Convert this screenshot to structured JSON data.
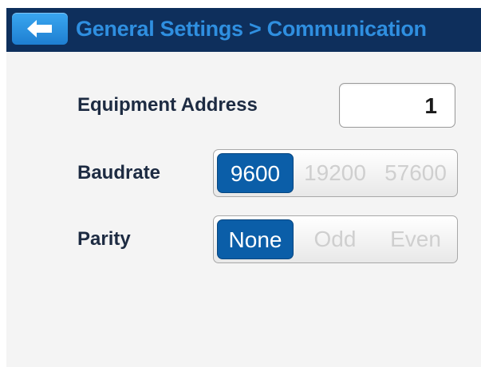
{
  "header": {
    "back_label": "back",
    "title": "General Settings > Communication"
  },
  "settings": {
    "equipment_address": {
      "label": "Equipment Address",
      "value": "1"
    },
    "baudrate": {
      "label": "Baudrate",
      "options": [
        "9600",
        "19200",
        "57600"
      ],
      "selected": "9600"
    },
    "parity": {
      "label": "Parity",
      "options": [
        "None",
        "Odd",
        "Even"
      ],
      "selected": "None"
    }
  },
  "colors": {
    "header_bg": "#0e2f5c",
    "title_text": "#2f8fe0",
    "selected_bg": "#0b5ea8",
    "label_text": "#1d2b42"
  }
}
